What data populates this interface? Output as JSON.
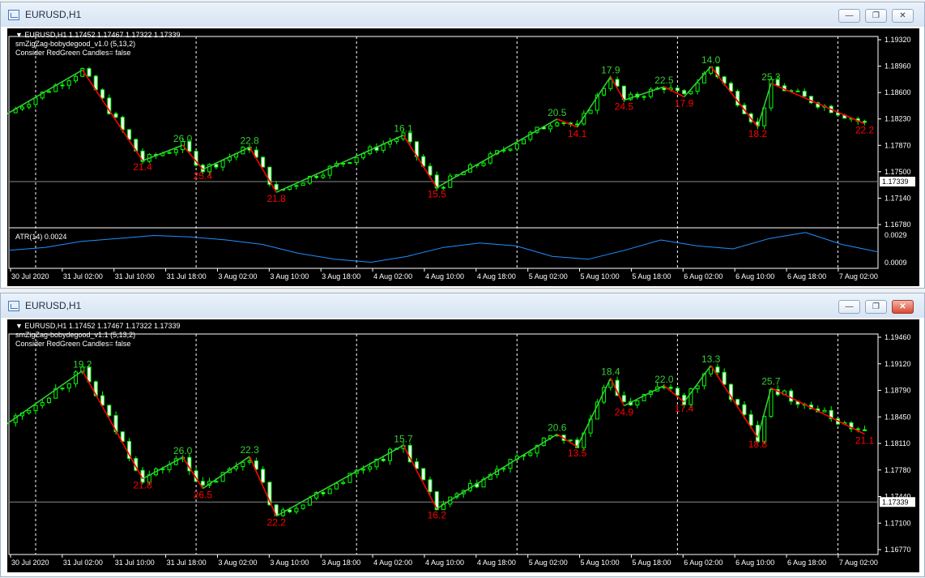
{
  "windows": [
    {
      "title": "EURUSD,H1",
      "header": {
        "symbol_line": "▼ EURUSD,H1  1.17452 1.17467 1.17322 1.17339",
        "indicator_line": "smZigZag-bobydegood_v1.0 (5,13,2)",
        "candles_line": "Consider RedGreen Candles= false"
      },
      "price_axis": [
        "1.19320",
        "1.18960",
        "1.18600",
        "1.18230",
        "1.17870",
        "1.17500",
        "1.17140",
        "1.16780"
      ],
      "current_price": "1.17339",
      "atr": {
        "label": "ATR(14) 0.0024",
        "axis": [
          "0.0029",
          "0.0009"
        ]
      },
      "time_axis": [
        "30 Jul 2020",
        "31 Jul 02:00",
        "31 Jul 10:00",
        "31 Jul 18:00",
        "3 Aug 02:00",
        "3 Aug 10:00",
        "3 Aug 18:00",
        "4 Aug 02:00",
        "4 Aug 10:00",
        "4 Aug 18:00",
        "5 Aug 02:00",
        "5 Aug 10:00",
        "5 Aug 18:00",
        "6 Aug 02:00",
        "6 Aug 10:00",
        "6 Aug 18:00",
        "7 Aug 02:00"
      ],
      "zigzag_labels": [
        "21.4",
        "26.0",
        "25.4",
        "22.8",
        "21.8",
        "16.1",
        "15.5",
        "20.5",
        "14.1",
        "17.9",
        "24.5",
        "22.5",
        "17.9",
        "14.0",
        "18.2",
        "25.3",
        "22.2"
      ]
    },
    {
      "title": "EURUSD,H1",
      "header": {
        "symbol_line": "▼ EURUSD,H1  1.17452 1.17467 1.17322 1.17339",
        "indicator_line": "smZigZag-bobydegood_v1.1 (5,13,2)",
        "candles_line": "Consider RedGreen Candles= false"
      },
      "price_axis": [
        "1.19460",
        "1.19120",
        "1.18790",
        "1.18450",
        "1.18110",
        "1.17780",
        "1.17440",
        "1.17100",
        "1.16770"
      ],
      "current_price": "1.17339",
      "time_axis": [
        "30 Jul 2020",
        "31 Jul 02:00",
        "31 Jul 10:00",
        "31 Jul 18:00",
        "3 Aug 02:00",
        "3 Aug 10:00",
        "3 Aug 18:00",
        "4 Aug 02:00",
        "4 Aug 10:00",
        "4 Aug 18:00",
        "5 Aug 02:00",
        "5 Aug 10:00",
        "5 Aug 18:00",
        "6 Aug 02:00",
        "6 Aug 10:00",
        "6 Aug 18:00",
        "7 Aug 02:00"
      ],
      "zigzag_labels": [
        "19.2",
        "21.8",
        "26.0",
        "26.5",
        "22.3",
        "22.2",
        "15.7",
        "16.2",
        "20.6",
        "13.5",
        "18.4",
        "24.9",
        "22.0",
        "17.4",
        "13.3",
        "18.8",
        "25.7",
        "21.1"
      ]
    }
  ],
  "window_controls": {
    "minimize": "—",
    "restore": "❐",
    "close": "✕"
  },
  "colors": {
    "bg": "#000000",
    "up": "#00ff00",
    "zigzag_up": "#32cd32",
    "zigzag_down": "#ff0000",
    "label_up": "#32cd32",
    "label_down": "#ff0000",
    "atr": "#1e90ff",
    "grid": "#ffffff"
  },
  "chart_data": [
    {
      "type": "line",
      "title": "EURUSD,H1",
      "series": [
        {
          "name": "smZigZag-bobydegood_v1.0 (5,13,2)",
          "x": [
            "30 Jul 2020",
            "31 Jul 07:00",
            "31 Jul 16:00",
            "31 Jul 22:00",
            "3 Aug 01:00",
            "3 Aug 08:00",
            "3 Aug 12:00",
            "4 Aug 07:00",
            "4 Aug 12:00",
            "5 Aug 06:00",
            "5 Aug 09:00",
            "5 Aug 14:00",
            "5 Aug 16:00",
            "5 Aug 22:00",
            "6 Aug 01:00",
            "6 Aug 05:00",
            "6 Aug 12:00",
            "6 Aug 14:00",
            "7 Aug 04:00"
          ],
          "values": [
            1.179,
            1.19,
            1.1765,
            1.1788,
            1.1752,
            1.1785,
            1.1718,
            1.1803,
            1.1725,
            1.1827,
            1.1815,
            1.189,
            1.1855,
            1.1875,
            1.186,
            1.1905,
            1.1815,
            1.188,
            1.182
          ]
        }
      ],
      "ylim": [
        1.167,
        1.1945
      ]
    },
    {
      "type": "line",
      "title": "ATR(14) 0.0024",
      "series": [
        {
          "name": "ATR(14)",
          "values": [
            0.0018,
            0.002,
            0.0024,
            0.0026,
            0.0028,
            0.0027,
            0.0025,
            0.0022,
            0.0016,
            0.0012,
            0.001,
            0.0014,
            0.002,
            0.0023,
            0.0021,
            0.0014,
            0.0012,
            0.0018,
            0.0025,
            0.0021,
            0.0019,
            0.0026,
            0.003,
            0.0022,
            0.0017
          ]
        }
      ],
      "ylim": [
        0.0007,
        0.0031
      ]
    },
    {
      "type": "line",
      "title": "EURUSD,H1",
      "series": [
        {
          "name": "smZigZag-bobydegood_v1.1 (5,13,2)",
          "x": [
            "30 Jul 2020",
            "31 Jul 07:00",
            "31 Jul 16:00",
            "31 Jul 22:00",
            "3 Aug 01:00",
            "3 Aug 08:00",
            "3 Aug 12:00",
            "4 Aug 07:00",
            "4 Aug 12:00",
            "5 Aug 06:00",
            "5 Aug 09:00",
            "5 Aug 14:00",
            "5 Aug 16:00",
            "5 Aug 22:00",
            "6 Aug 01:00",
            "6 Aug 05:00",
            "6 Aug 12:00",
            "6 Aug 14:00",
            "7 Aug 04:00"
          ],
          "values": [
            1.179,
            1.191,
            1.1765,
            1.1794,
            1.1752,
            1.1795,
            1.1715,
            1.181,
            1.1725,
            1.1825,
            1.1808,
            1.19,
            1.1863,
            1.189,
            1.1868,
            1.1917,
            1.182,
            1.1887,
            1.1825
          ]
        }
      ],
      "ylim": [
        1.167,
        1.1955
      ]
    }
  ]
}
